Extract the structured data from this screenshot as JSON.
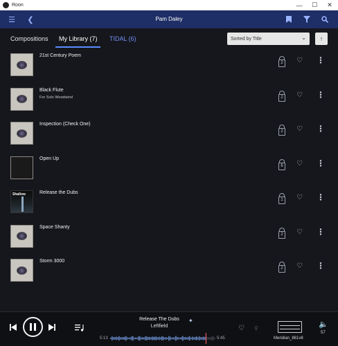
{
  "window": {
    "title": "Roon"
  },
  "header": {
    "title": "Pam Daley"
  },
  "tabs": [
    {
      "label": "Compositions"
    },
    {
      "label": "My Library (7)"
    },
    {
      "label": "TIDAL (6)"
    }
  ],
  "sort": {
    "label": "Sorted by Title"
  },
  "albums": [
    {
      "title": "21st Century Poem",
      "subtitle": "",
      "versions": "2"
    },
    {
      "title": "Black Flute",
      "subtitle": "For Solo Woodwind",
      "versions": "2"
    },
    {
      "title": "Inspection (Check One)",
      "subtitle": "",
      "versions": "2"
    },
    {
      "title": "Open Up",
      "subtitle": "",
      "versions": "6"
    },
    {
      "title": "Release the Dubs",
      "subtitle": "",
      "versions": "1"
    },
    {
      "title": "Space Shanty",
      "subtitle": "",
      "versions": "2"
    },
    {
      "title": "Storm 3000",
      "subtitle": "",
      "versions": "2"
    }
  ],
  "release_dubs_cover_text": "Shallow",
  "now_playing": {
    "title": "Release The Dubs",
    "artist": "Leftfield",
    "elapsed": "5:13",
    "duration": "5:45",
    "progress": 0.907
  },
  "zone": {
    "name": "Meridian_861v8"
  },
  "volume": {
    "value": "57"
  },
  "colors": {
    "header_bg": "#1e2e66",
    "accent": "#5b8cff",
    "tidal": "#6f8df5",
    "background": "#16171c"
  }
}
